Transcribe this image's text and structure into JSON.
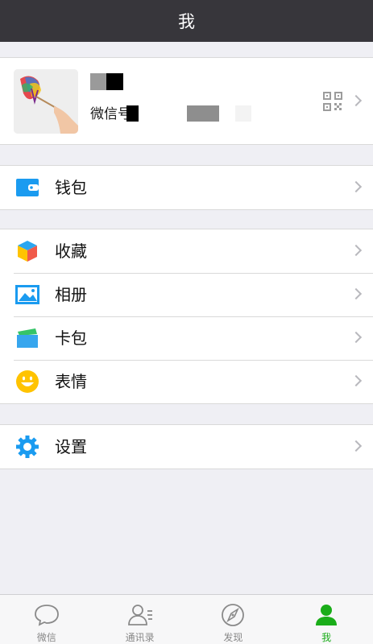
{
  "header": {
    "title": "我"
  },
  "profile": {
    "wechat_id_label": "微信号"
  },
  "sections": {
    "wallet": [
      {
        "label": "钱包",
        "icon": "wallet-icon"
      }
    ],
    "main": [
      {
        "label": "收藏",
        "icon": "favorites-cube-icon"
      },
      {
        "label": "相册",
        "icon": "album-icon"
      },
      {
        "label": "卡包",
        "icon": "card-package-icon"
      },
      {
        "label": "表情",
        "icon": "sticker-smile-icon"
      }
    ],
    "settings": [
      {
        "label": "设置",
        "icon": "gear-icon"
      }
    ]
  },
  "tabbar": {
    "tabs": [
      {
        "label": "微信",
        "icon": "chat-bubble-icon",
        "active": false
      },
      {
        "label": "通讯录",
        "icon": "contacts-icon",
        "active": false
      },
      {
        "label": "发现",
        "icon": "compass-icon",
        "active": false
      },
      {
        "label": "我",
        "icon": "person-icon",
        "active": true
      }
    ]
  },
  "colors": {
    "nav_bg": "#37363b",
    "accent_green": "#1aad19",
    "icon_blue": "#1a9bf0",
    "sticker_yellow": "#ffc300"
  }
}
